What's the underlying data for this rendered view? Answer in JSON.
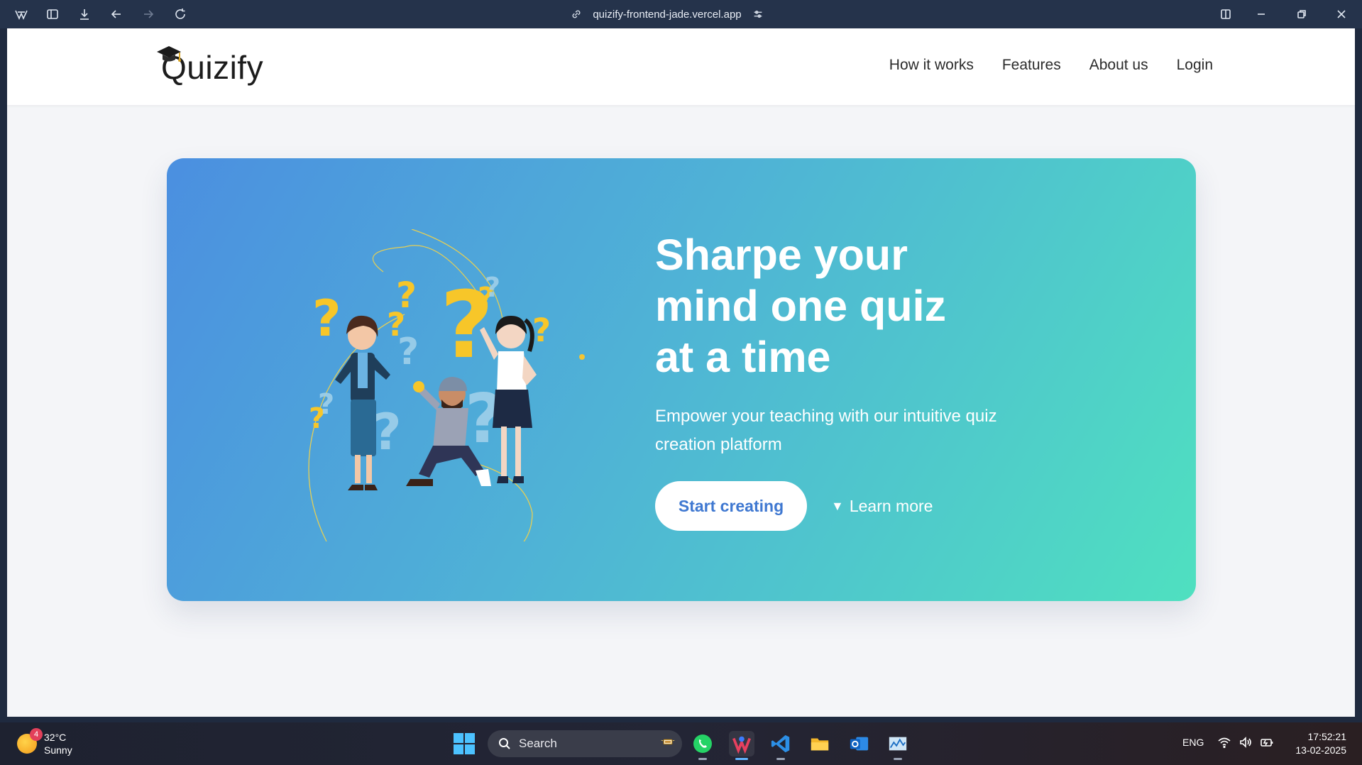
{
  "browser": {
    "url": "quizify-frontend-jade.vercel.app"
  },
  "site": {
    "logo_text": "Quizify",
    "nav": [
      {
        "label": "How it works"
      },
      {
        "label": "Features"
      },
      {
        "label": "About us"
      },
      {
        "label": "Login"
      }
    ]
  },
  "hero": {
    "title_line1": "Sharpe your",
    "title_line2": "mind one quiz",
    "title_line3": "at a time",
    "subtitle": "Empower your teaching with our intuitive quiz creation platform",
    "cta_primary": "Start creating",
    "cta_secondary": "Learn more",
    "cta_secondary_icon": "triangle-down-icon",
    "gradient_start": "#4b8fe0",
    "gradient_end": "#4fe0c0",
    "accent": "#3f78d1"
  },
  "taskbar": {
    "weather_temp": "32°C",
    "weather_desc": "Sunny",
    "notification_count": "4",
    "search_placeholder": "Search",
    "language": "ENG",
    "time": "17:52:21",
    "date": "13-02-2025"
  }
}
